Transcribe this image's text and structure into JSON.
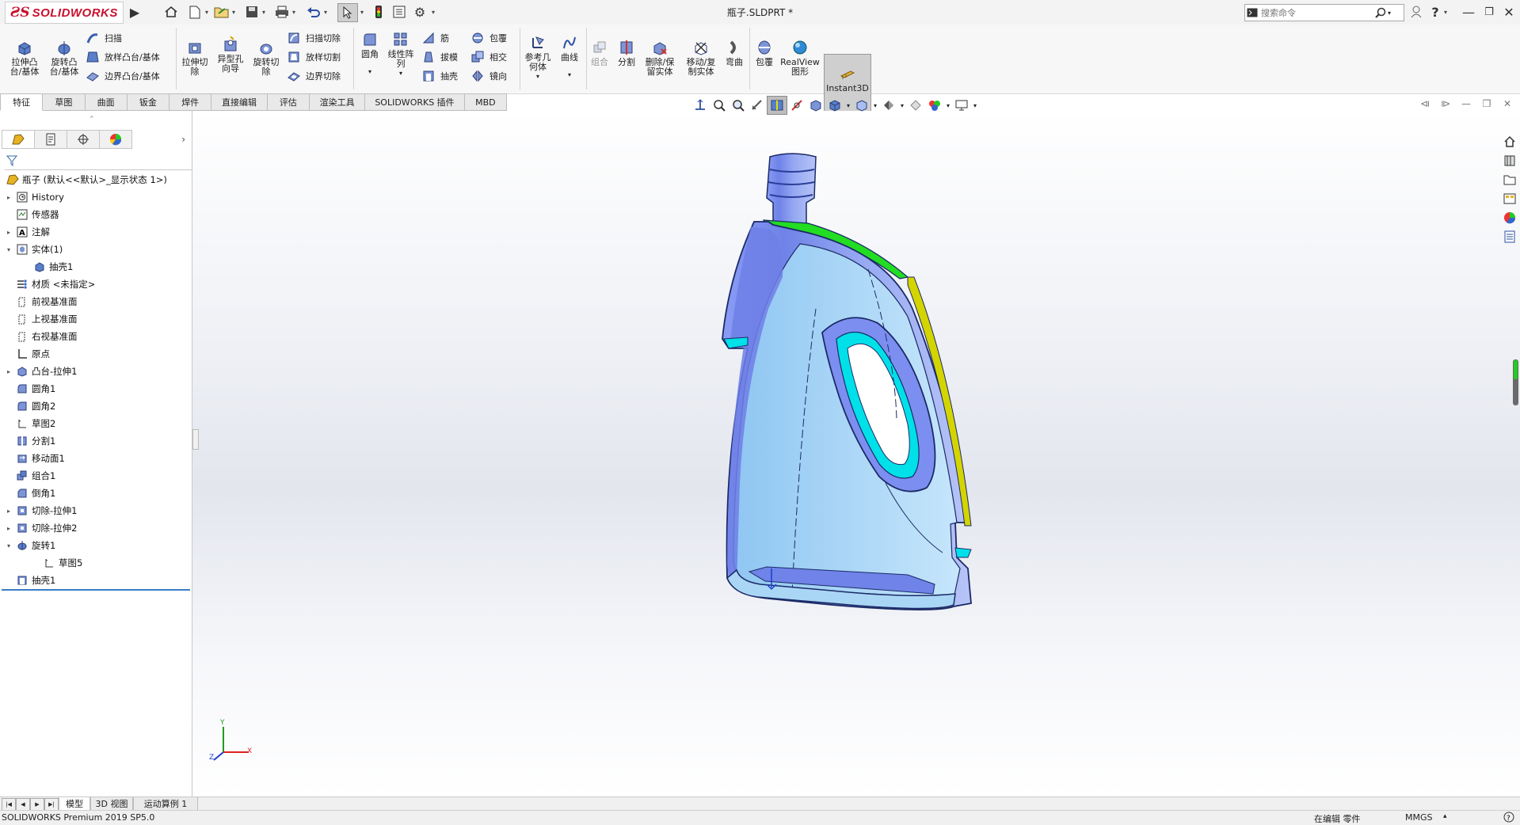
{
  "app": {
    "brand_ds": "ƧS",
    "brand_name": "SOLIDWORKS",
    "document_title": "瓶子.SLDPRT *"
  },
  "search": {
    "placeholder": "搜索命令"
  },
  "ribbon": {
    "extrude_boss": "拉伸凸\n台/基体",
    "revolve_boss": "旋转凸\n台/基体",
    "sweep": "扫描",
    "loft_boss": "放样凸台/基体",
    "boundary_boss": "边界凸台/基体",
    "extrude_cut": "拉伸切\n除",
    "hole_wizard": "异型孔\n向导",
    "revolve_cut": "旋转切\n除",
    "swept_cut": "扫描切除",
    "lofted_cut": "放样切割",
    "boundary_cut": "边界切除",
    "fillet": "圆角",
    "linear_pattern": "线性阵\n列",
    "rib": "筋",
    "draft": "拔模",
    "shell": "抽壳",
    "wrap": "包覆",
    "intersect": "相交",
    "mirror": "镜向",
    "ref_geometry": "参考几\n何体",
    "curves": "曲线",
    "combine": "组合",
    "split": "分割",
    "delete_keep": "删除/保\n留实体",
    "move_copy": "移动/复\n制实体",
    "flex": "弯曲",
    "wrap2": "包覆",
    "realview": "RealView\n图形",
    "instant3d": "Instant3D"
  },
  "tabs": [
    "特征",
    "草图",
    "曲面",
    "钣金",
    "焊件",
    "直接编辑",
    "评估",
    "渲染工具",
    "SOLIDWORKS 插件",
    "MBD"
  ],
  "tree": {
    "root": "瓶子 (默认<<默认>_显示状态 1>)",
    "items": [
      "History",
      "传感器",
      "注解",
      "实体(1)",
      "抽壳1",
      "材质 <未指定>",
      "前视基准面",
      "上视基准面",
      "右视基准面",
      "原点",
      "凸台-拉伸1",
      "圆角1",
      "圆角2",
      "草图2",
      "分割1",
      "移动面1",
      "组合1",
      "倒角1",
      "切除-拉伸1",
      "切除-拉伸2",
      "旋转1",
      "草图5",
      "抽壳1"
    ]
  },
  "bottom_tabs": [
    "模型",
    "3D 视图",
    "运动算例 1"
  ],
  "status": {
    "version": "SOLIDWORKS Premium 2019 SP5.0",
    "editing": "在编辑 零件",
    "units": "MMGS"
  },
  "triad": {
    "x": "X",
    "y": "Y",
    "z": "Z"
  },
  "colors": {
    "brand_red": "#c8102e",
    "model_blue": "#7c8ff0",
    "model_light": "#a9d6f5",
    "section_green": "#22dd22",
    "section_yellow": "#d4d400",
    "section_cyan": "#00e0e8"
  }
}
